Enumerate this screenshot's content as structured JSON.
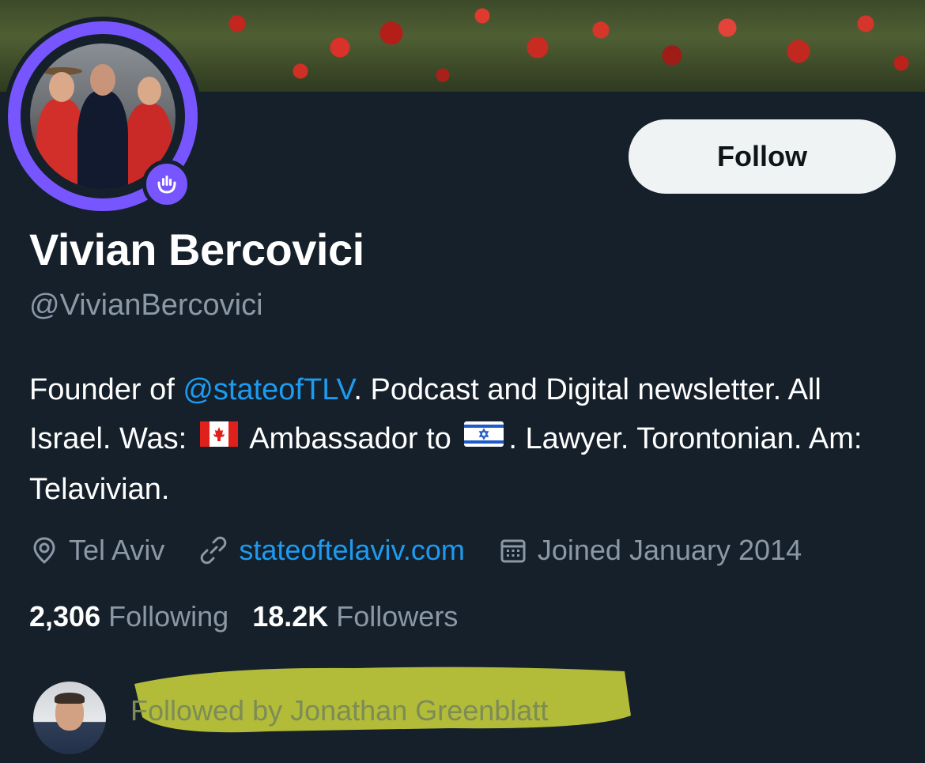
{
  "profile": {
    "display_name": "Vivian Bercovici",
    "handle": "@VivianBercovici",
    "follow_label": "Follow",
    "bio": {
      "part1": "Founder of ",
      "mention": "@stateofTLV",
      "part2": ". Podcast and Digital newsletter. All Israel. Was: ",
      "part3": " Ambassador to ",
      "part4": ". Lawyer. Torontonian. Am: Telavivian."
    },
    "location": "Tel Aviv",
    "website": "stateoftelaviv.com",
    "joined": "Joined January 2014",
    "following_count": "2,306",
    "following_label": "Following",
    "followers_count": "18.2K",
    "followers_label": "Followers",
    "followed_by": "Followed by Jonathan Greenblatt"
  },
  "icons": {
    "location": "location-pin-icon",
    "website": "link-icon",
    "joined": "calendar-icon",
    "spaces": "spaces-microphone-icon",
    "flag_canada": "canada-flag-icon",
    "flag_israel": "israel-flag-icon"
  },
  "colors": {
    "background": "#15202b",
    "accent_blue": "#1d9bf0",
    "secondary_text": "#8b98a5",
    "spaces_purple": "#7856ff",
    "follow_button_bg": "#eff3f4",
    "highlighter": "#c8d23a"
  }
}
